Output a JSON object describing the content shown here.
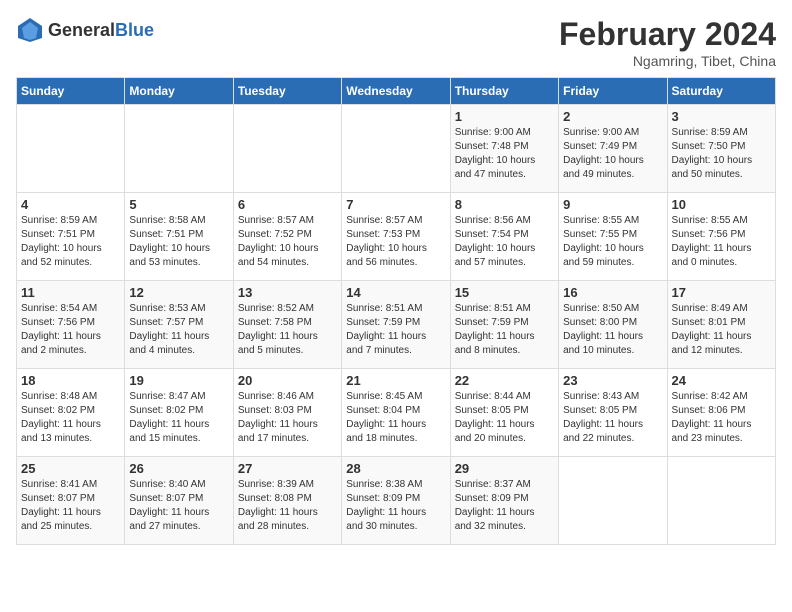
{
  "header": {
    "logo_general": "General",
    "logo_blue": "Blue",
    "month": "February 2024",
    "location": "Ngamring, Tibet, China"
  },
  "weekdays": [
    "Sunday",
    "Monday",
    "Tuesday",
    "Wednesday",
    "Thursday",
    "Friday",
    "Saturday"
  ],
  "weeks": [
    [
      {
        "day": "",
        "info": ""
      },
      {
        "day": "",
        "info": ""
      },
      {
        "day": "",
        "info": ""
      },
      {
        "day": "",
        "info": ""
      },
      {
        "day": "1",
        "info": "Sunrise: 9:00 AM\nSunset: 7:48 PM\nDaylight: 10 hours\nand 47 minutes."
      },
      {
        "day": "2",
        "info": "Sunrise: 9:00 AM\nSunset: 7:49 PM\nDaylight: 10 hours\nand 49 minutes."
      },
      {
        "day": "3",
        "info": "Sunrise: 8:59 AM\nSunset: 7:50 PM\nDaylight: 10 hours\nand 50 minutes."
      }
    ],
    [
      {
        "day": "4",
        "info": "Sunrise: 8:59 AM\nSunset: 7:51 PM\nDaylight: 10 hours\nand 52 minutes."
      },
      {
        "day": "5",
        "info": "Sunrise: 8:58 AM\nSunset: 7:51 PM\nDaylight: 10 hours\nand 53 minutes."
      },
      {
        "day": "6",
        "info": "Sunrise: 8:57 AM\nSunset: 7:52 PM\nDaylight: 10 hours\nand 54 minutes."
      },
      {
        "day": "7",
        "info": "Sunrise: 8:57 AM\nSunset: 7:53 PM\nDaylight: 10 hours\nand 56 minutes."
      },
      {
        "day": "8",
        "info": "Sunrise: 8:56 AM\nSunset: 7:54 PM\nDaylight: 10 hours\nand 57 minutes."
      },
      {
        "day": "9",
        "info": "Sunrise: 8:55 AM\nSunset: 7:55 PM\nDaylight: 10 hours\nand 59 minutes."
      },
      {
        "day": "10",
        "info": "Sunrise: 8:55 AM\nSunset: 7:56 PM\nDaylight: 11 hours\nand 0 minutes."
      }
    ],
    [
      {
        "day": "11",
        "info": "Sunrise: 8:54 AM\nSunset: 7:56 PM\nDaylight: 11 hours\nand 2 minutes."
      },
      {
        "day": "12",
        "info": "Sunrise: 8:53 AM\nSunset: 7:57 PM\nDaylight: 11 hours\nand 4 minutes."
      },
      {
        "day": "13",
        "info": "Sunrise: 8:52 AM\nSunset: 7:58 PM\nDaylight: 11 hours\nand 5 minutes."
      },
      {
        "day": "14",
        "info": "Sunrise: 8:51 AM\nSunset: 7:59 PM\nDaylight: 11 hours\nand 7 minutes."
      },
      {
        "day": "15",
        "info": "Sunrise: 8:51 AM\nSunset: 7:59 PM\nDaylight: 11 hours\nand 8 minutes."
      },
      {
        "day": "16",
        "info": "Sunrise: 8:50 AM\nSunset: 8:00 PM\nDaylight: 11 hours\nand 10 minutes."
      },
      {
        "day": "17",
        "info": "Sunrise: 8:49 AM\nSunset: 8:01 PM\nDaylight: 11 hours\nand 12 minutes."
      }
    ],
    [
      {
        "day": "18",
        "info": "Sunrise: 8:48 AM\nSunset: 8:02 PM\nDaylight: 11 hours\nand 13 minutes."
      },
      {
        "day": "19",
        "info": "Sunrise: 8:47 AM\nSunset: 8:02 PM\nDaylight: 11 hours\nand 15 minutes."
      },
      {
        "day": "20",
        "info": "Sunrise: 8:46 AM\nSunset: 8:03 PM\nDaylight: 11 hours\nand 17 minutes."
      },
      {
        "day": "21",
        "info": "Sunrise: 8:45 AM\nSunset: 8:04 PM\nDaylight: 11 hours\nand 18 minutes."
      },
      {
        "day": "22",
        "info": "Sunrise: 8:44 AM\nSunset: 8:05 PM\nDaylight: 11 hours\nand 20 minutes."
      },
      {
        "day": "23",
        "info": "Sunrise: 8:43 AM\nSunset: 8:05 PM\nDaylight: 11 hours\nand 22 minutes."
      },
      {
        "day": "24",
        "info": "Sunrise: 8:42 AM\nSunset: 8:06 PM\nDaylight: 11 hours\nand 23 minutes."
      }
    ],
    [
      {
        "day": "25",
        "info": "Sunrise: 8:41 AM\nSunset: 8:07 PM\nDaylight: 11 hours\nand 25 minutes."
      },
      {
        "day": "26",
        "info": "Sunrise: 8:40 AM\nSunset: 8:07 PM\nDaylight: 11 hours\nand 27 minutes."
      },
      {
        "day": "27",
        "info": "Sunrise: 8:39 AM\nSunset: 8:08 PM\nDaylight: 11 hours\nand 28 minutes."
      },
      {
        "day": "28",
        "info": "Sunrise: 8:38 AM\nSunset: 8:09 PM\nDaylight: 11 hours\nand 30 minutes."
      },
      {
        "day": "29",
        "info": "Sunrise: 8:37 AM\nSunset: 8:09 PM\nDaylight: 11 hours\nand 32 minutes."
      },
      {
        "day": "",
        "info": ""
      },
      {
        "day": "",
        "info": ""
      }
    ]
  ]
}
